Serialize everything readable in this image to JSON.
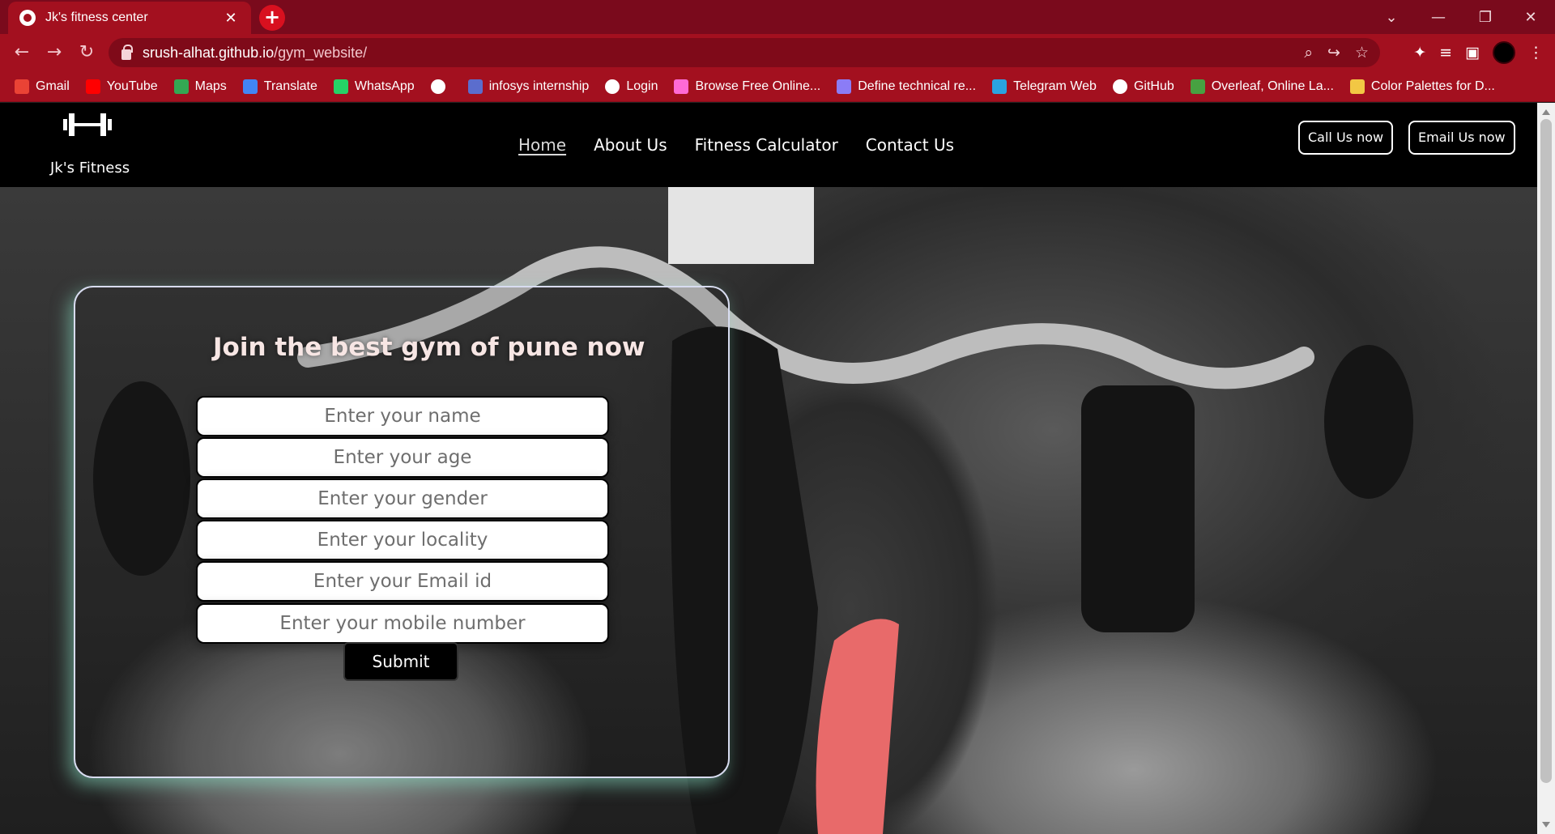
{
  "browser": {
    "tab_title": "Jk's fitness center",
    "tab_close": "✕",
    "new_tab": "+",
    "url_host": "srush-alhat.github.io",
    "url_path": "/gym_website/",
    "window_minimize": "—",
    "window_restore": "❐",
    "window_close": "✕",
    "tab_search": "⌄",
    "back": "←",
    "forward": "→",
    "reload": "↻",
    "bookmarks": [
      {
        "label": "Gmail",
        "color": "#ea4335"
      },
      {
        "label": "YouTube",
        "color": "#ff0000"
      },
      {
        "label": "Maps",
        "color": "#34a853"
      },
      {
        "label": "Translate",
        "color": "#4285f4"
      },
      {
        "label": "WhatsApp",
        "color": "#25d366"
      },
      {
        "label": "",
        "color": "#ffffff"
      },
      {
        "label": "infosys internship",
        "color": "#5b6dcd"
      },
      {
        "label": "Login",
        "color": "#ffffff"
      },
      {
        "label": "Browse Free Online...",
        "color": "#ff6ad5"
      },
      {
        "label": "Define technical re...",
        "color": "#8b7cf6"
      },
      {
        "label": "Telegram Web",
        "color": "#2aa3e0"
      },
      {
        "label": "GitHub",
        "color": "#ffffff"
      },
      {
        "label": "Overleaf, Online La...",
        "color": "#47a141"
      },
      {
        "label": "Color Palettes for D...",
        "color": "#f2c744"
      }
    ]
  },
  "site": {
    "brand": "Jk's Fitness",
    "nav": [
      {
        "label": "Home",
        "active": true
      },
      {
        "label": "About Us",
        "active": false
      },
      {
        "label": "Fitness Calculator",
        "active": false
      },
      {
        "label": "Contact Us",
        "active": false
      }
    ],
    "call_button": "Call Us now",
    "email_button": "Email Us now"
  },
  "form": {
    "title": "Join the best gym of pune now",
    "fields": [
      {
        "placeholder": "Enter your name",
        "value": ""
      },
      {
        "placeholder": "Enter your age",
        "value": ""
      },
      {
        "placeholder": "Enter your gender",
        "value": ""
      },
      {
        "placeholder": "Enter your locality",
        "value": ""
      },
      {
        "placeholder": "Enter your Email id",
        "value": ""
      },
      {
        "placeholder": "Enter your mobile number",
        "value": ""
      }
    ],
    "submit_label": "Submit"
  },
  "colors": {
    "tabbar": "#7a0a1c",
    "toolbar": "#a3101f",
    "header": "#000000",
    "card_glow": "#8ce6c8"
  }
}
